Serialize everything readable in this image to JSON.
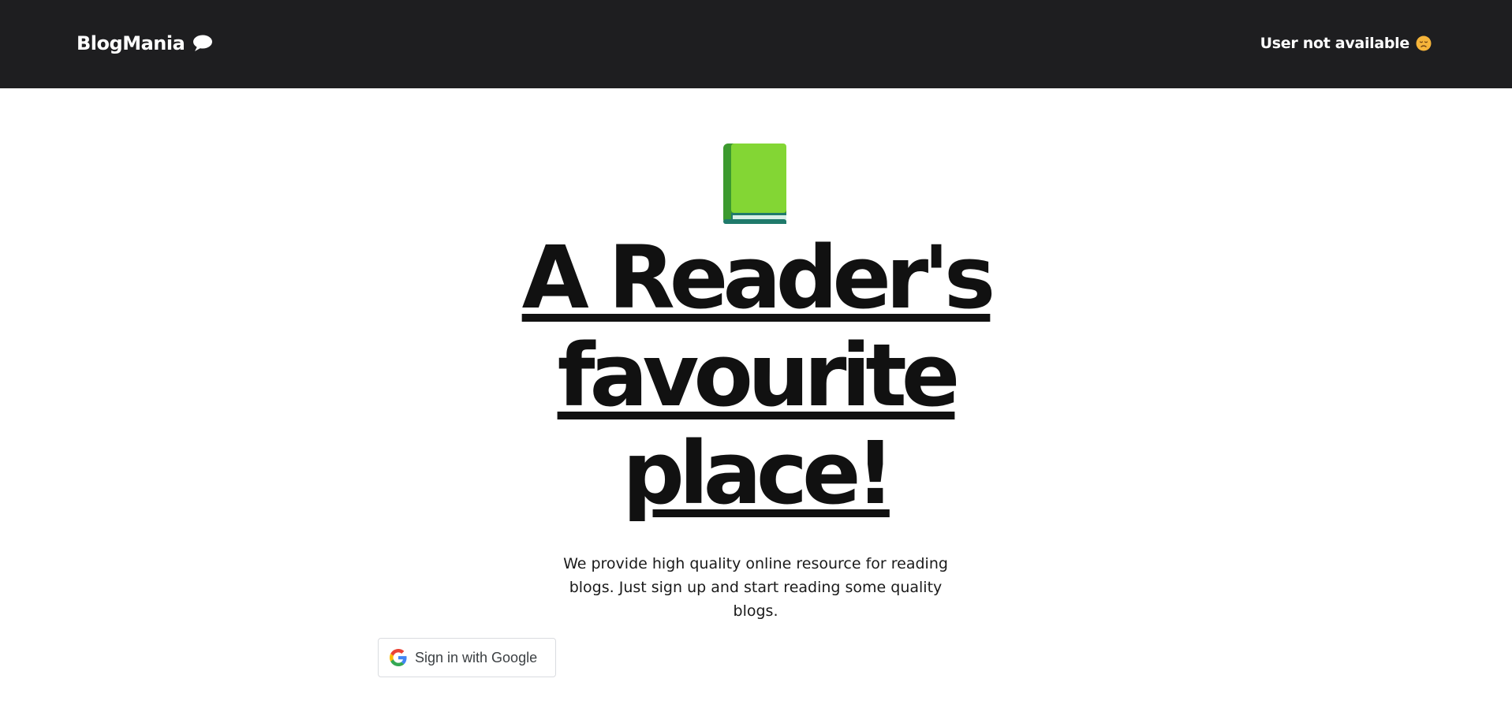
{
  "navbar": {
    "brand": "BlogMania",
    "brand_icon": "speech-bubble-icon",
    "user_status": "User not available",
    "user_status_icon": "sad-face-emoji-icon",
    "background_color": "#1e1e20"
  },
  "hero": {
    "icon": "green-book-icon",
    "headline_lines": [
      "A Reader's",
      "favourite",
      "place!"
    ],
    "description": "We provide high quality online resource for reading blogs. Just sign up and start reading some quality blogs."
  },
  "auth": {
    "google_button_label": "Sign in with Google",
    "google_icon": "google-g-icon"
  }
}
